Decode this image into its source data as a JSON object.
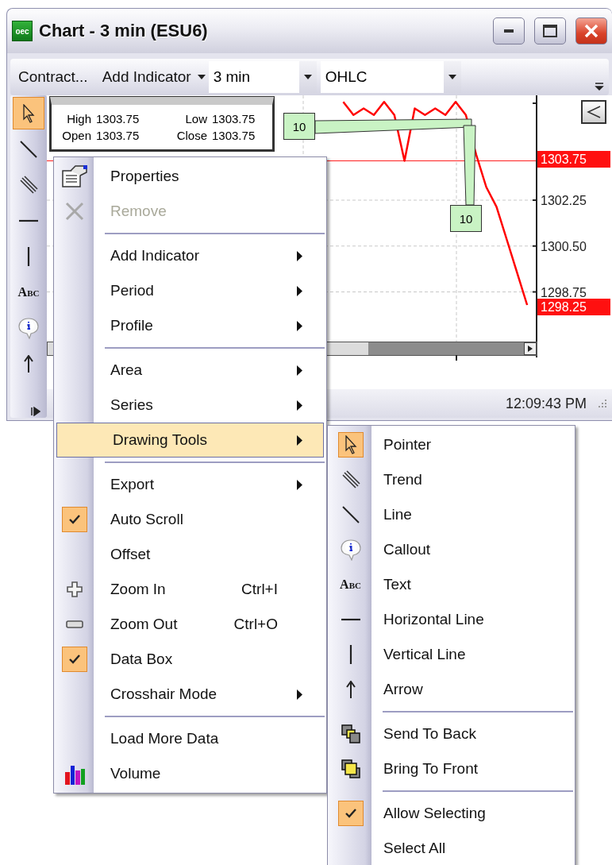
{
  "window": {
    "logo": "oec",
    "title": "Chart - 3 min (ESU6)"
  },
  "toolbar": {
    "items": [
      {
        "kind": "button",
        "label": "Contract..."
      },
      {
        "kind": "menu_button",
        "label": "Add Indicator"
      },
      {
        "kind": "combo",
        "value": "3 min"
      },
      {
        "kind": "combo",
        "value": "OHLC"
      }
    ]
  },
  "drawing_toolbar": {
    "tools": [
      {
        "kind": "pointer",
        "selected": true
      },
      {
        "kind": "line",
        "selected": false
      },
      {
        "kind": "trend",
        "selected": false
      },
      {
        "kind": "hline",
        "selected": false
      },
      {
        "kind": "vline",
        "selected": false
      },
      {
        "kind": "text",
        "label": "Abc",
        "selected": false
      },
      {
        "kind": "callout",
        "selected": false
      },
      {
        "kind": "arrow",
        "selected": false
      }
    ]
  },
  "chart": {
    "data_box": {
      "cells": [
        {
          "label": "High",
          "value": "1303.75"
        },
        {
          "label": "Low",
          "value": "1303.75"
        },
        {
          "label": "Open",
          "value": "1303.75"
        },
        {
          "label": "Close",
          "value": "1303.75"
        }
      ]
    },
    "callouts": [
      "10",
      "10"
    ],
    "chart_data": {
      "type": "line",
      "ylim": [
        1296.25,
        1306.25
      ],
      "grid": true,
      "ref_lines": [
        {
          "axis": "y",
          "value": 1303.75,
          "color": "#ff2020"
        }
      ],
      "yticks": [
        {
          "value": 1302.25,
          "label": "1302.25"
        },
        {
          "value": 1300.5,
          "label": "1300.50"
        },
        {
          "value": 1298.75,
          "label": "1298.75"
        }
      ],
      "series": [
        {
          "color": "#ff0000",
          "values": [
            null,
            null,
            null,
            null,
            null,
            null,
            null,
            null,
            null,
            null,
            null,
            null,
            null,
            null,
            null,
            null,
            null,
            null,
            null,
            null,
            null,
            null,
            null,
            null,
            null,
            null,
            null,
            null,
            null,
            1306.0,
            1305.5,
            1305.75,
            1305.5,
            1306.0,
            1305.5,
            1303.75,
            1305.75,
            1305.5,
            1305.75,
            1305.5,
            1306.0,
            1305.5,
            1304.0,
            1302.75,
            1302.0,
            1300.75,
            1299.5,
            1298.25,
            null
          ]
        }
      ]
    },
    "price_tags": [
      "1303.75",
      "1298.25"
    ]
  },
  "status_bar": {
    "time": "12:09:43 PM"
  },
  "context_menu": {
    "items": [
      {
        "kind": "properties",
        "label": "Properties",
        "disabled": false,
        "checked": false,
        "submenu": false,
        "selected": false
      },
      {
        "kind": "remove",
        "label": "Remove",
        "disabled": true,
        "checked": false,
        "submenu": false,
        "selected": false
      },
      {
        "kind": "separator"
      },
      {
        "kind": "command",
        "label": "Add Indicator",
        "disabled": false,
        "checked": false,
        "submenu": true,
        "selected": false
      },
      {
        "kind": "command",
        "label": "Period",
        "disabled": false,
        "checked": false,
        "submenu": true,
        "selected": false
      },
      {
        "kind": "command",
        "label": "Profile",
        "disabled": false,
        "checked": false,
        "submenu": true,
        "selected": false
      },
      {
        "kind": "separator"
      },
      {
        "kind": "command",
        "label": "Area",
        "disabled": false,
        "checked": false,
        "submenu": true,
        "selected": false
      },
      {
        "kind": "command",
        "label": "Series",
        "disabled": false,
        "checked": false,
        "submenu": true,
        "selected": false
      },
      {
        "kind": "command",
        "label": "Drawing Tools",
        "disabled": false,
        "checked": false,
        "submenu": true,
        "selected": true
      },
      {
        "kind": "separator"
      },
      {
        "kind": "command",
        "label": "Export",
        "disabled": false,
        "checked": false,
        "submenu": true,
        "selected": false
      },
      {
        "kind": "command",
        "label": "Auto Scroll",
        "disabled": false,
        "checked": true,
        "submenu": false,
        "selected": false
      },
      {
        "kind": "command",
        "label": "Offset",
        "disabled": false,
        "checked": false,
        "submenu": false,
        "selected": false
      },
      {
        "kind": "zoom_in",
        "label": "Zoom In",
        "shortcut": "Ctrl+I",
        "disabled": false,
        "checked": false,
        "submenu": false,
        "selected": false
      },
      {
        "kind": "zoom_out",
        "label": "Zoom Out",
        "shortcut": "Ctrl+O",
        "disabled": false,
        "checked": false,
        "submenu": false,
        "selected": false
      },
      {
        "kind": "command",
        "label": "Data Box",
        "disabled": false,
        "checked": true,
        "submenu": false,
        "selected": false
      },
      {
        "kind": "command",
        "label": "Crosshair Mode",
        "disabled": false,
        "checked": false,
        "submenu": true,
        "selected": false
      },
      {
        "kind": "separator"
      },
      {
        "kind": "command",
        "label": "Load More Data",
        "disabled": false,
        "checked": false,
        "submenu": false,
        "selected": false
      },
      {
        "kind": "volume",
        "label": "Volume",
        "disabled": false,
        "checked": false,
        "submenu": false,
        "selected": false
      }
    ]
  },
  "drawing_tools_menu": {
    "items": [
      {
        "kind": "pointer",
        "label": "Pointer",
        "checked": true,
        "selected": false
      },
      {
        "kind": "trend",
        "label": "Trend",
        "checked": false,
        "selected": false
      },
      {
        "kind": "line",
        "label": "Line",
        "checked": false,
        "selected": false
      },
      {
        "kind": "callout",
        "label": "Callout",
        "checked": false,
        "selected": false
      },
      {
        "kind": "text",
        "label": "Text",
        "icon_text": "Abc",
        "checked": false,
        "selected": false
      },
      {
        "kind": "hline",
        "label": "Horizontal Line",
        "checked": false,
        "selected": false
      },
      {
        "kind": "vline",
        "label": "Vertical Line",
        "checked": false,
        "selected": false
      },
      {
        "kind": "arrow",
        "label": "Arrow",
        "checked": false,
        "selected": false
      },
      {
        "kind": "separator"
      },
      {
        "kind": "send_back",
        "label": "Send To Back",
        "checked": false,
        "selected": false
      },
      {
        "kind": "bring_front",
        "label": "Bring To Front",
        "checked": false,
        "selected": false
      },
      {
        "kind": "separator"
      },
      {
        "kind": "command",
        "label": "Allow Selecting",
        "checked": true,
        "selected": false
      },
      {
        "kind": "command",
        "label": "Select All",
        "checked": false,
        "selected": false
      }
    ]
  }
}
